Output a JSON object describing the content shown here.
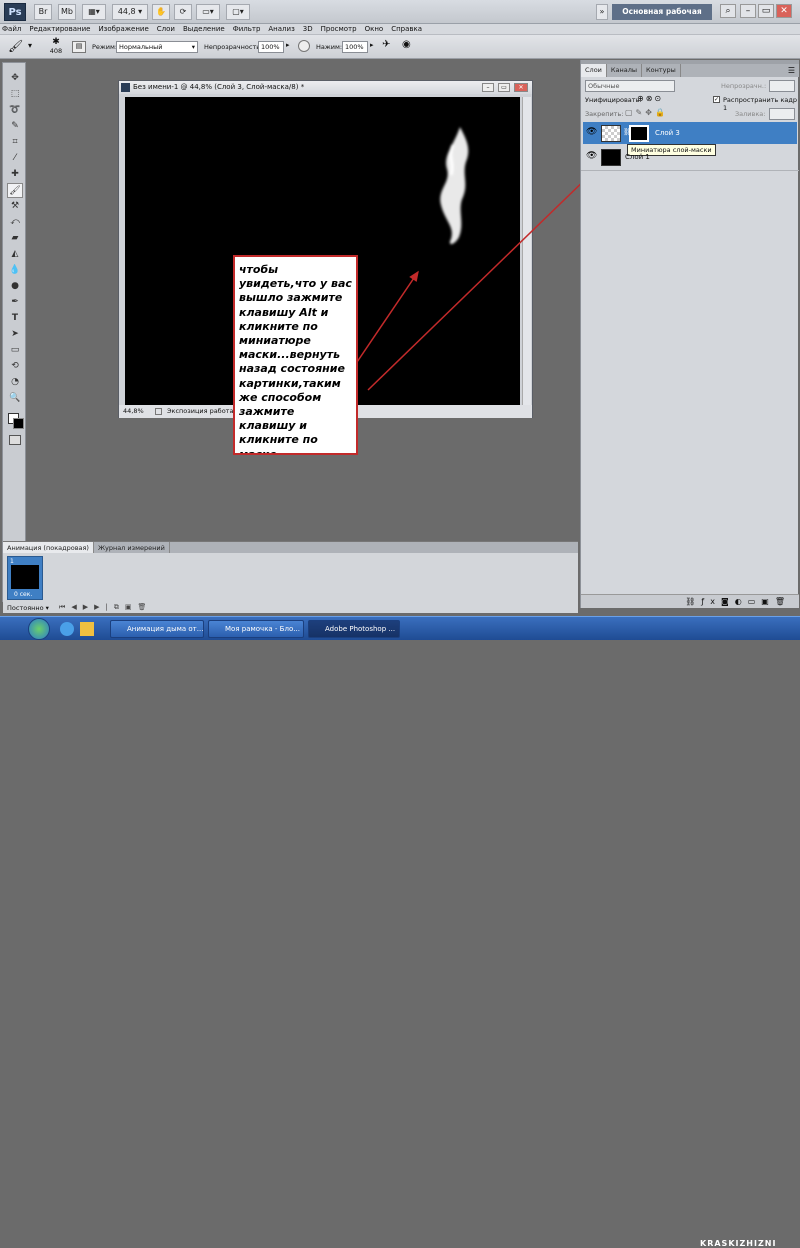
{
  "app": {
    "logo": "Ps",
    "workspace": "Основная рабочая среда",
    "zoom": "44,8"
  },
  "menu": [
    "Файл",
    "Редактирование",
    "Изображение",
    "Слои",
    "Выделение",
    "Фильтр",
    "Анализ",
    "3D",
    "Просмотр",
    "Окно",
    "Справка"
  ],
  "options": {
    "brush_size": "408",
    "mode_label": "Режим:",
    "mode_value": "Нормальный",
    "opacity_label": "Непрозрачность:",
    "opacity_value": "100%",
    "flow_label": "Нажим:",
    "flow_value": "100%"
  },
  "document": {
    "title": "Без имени-1 @ 44,8% (Слой 3, Слой-маска/8) *",
    "status_zoom": "44,8%",
    "status_text": "Экспозиция работает"
  },
  "callout": {
    "text": "чтобы увидеть,что у вас вышло  зажмите клавишу Alt  и кликните по миниатюре маски...вернуть назад состояние картинки,таким же способом зажмите  клавишу и кликните по маске"
  },
  "layers_panel": {
    "tabs": [
      "Слои",
      "Каналы",
      "Контуры"
    ],
    "blend_mode": "Обычные",
    "opacity_label": "Непрозрачн.:",
    "unify_label": "Унифицировать:",
    "propagate_label": "Распространить кадр 1",
    "lock_label": "Закрепить:",
    "fill_label": "Заливка:",
    "layers": [
      {
        "name": "Слой 3"
      },
      {
        "name": "Слой 1"
      }
    ],
    "tooltip": "Миниатюра слой-маски"
  },
  "animation": {
    "tabs": [
      "Анимация (покадровая)",
      "Журнал измерений"
    ],
    "frame_number": "1",
    "frame_delay": "0 сек.",
    "loop": "Постоянно"
  },
  "taskbar": {
    "items": [
      "Анимация дыма от...",
      "Моя рамочка - Бло...",
      "Adobe Photoshop ..."
    ]
  },
  "watermark": "KRASKIZHIZNI",
  "colors": {
    "accent_red": "#c22a2a",
    "selection_blue": "#3f7fc4",
    "taskbar_blue": "#245ba8"
  }
}
